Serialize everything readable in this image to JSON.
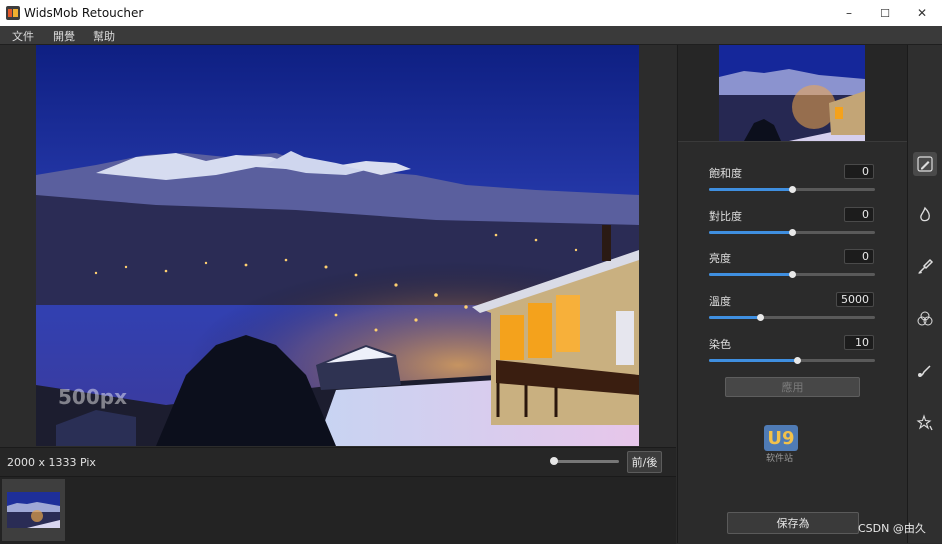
{
  "window": {
    "title": "WidsMob Retoucher",
    "controls": [
      "–",
      "☐",
      "✕"
    ]
  },
  "menu": [
    "文件",
    "開覺",
    "幫助"
  ],
  "image_info": "2000 x 1333 Pix",
  "image_watermark": "500px",
  "zoom": {
    "level": 0.05
  },
  "before_after_label": "前/後",
  "adjustments": [
    {
      "label": "飽和度",
      "value": "0",
      "position": 0.5
    },
    {
      "label": "對比度",
      "value": "0",
      "position": 0.5
    },
    {
      "label": "亮度",
      "value": "0",
      "position": 0.5
    },
    {
      "label": "溫度",
      "value": "5000",
      "position": 0.31
    },
    {
      "label": "染色",
      "value": "10",
      "position": 0.53
    }
  ],
  "apply_label": "應用",
  "watermark": {
    "text": "U9",
    "sub": "软件站"
  },
  "save_label": "保存為",
  "tools": [
    "pencil-icon",
    "flame-icon",
    "brush-icon",
    "color-circles-icon",
    "retouch-brush-icon",
    "magic-stars-icon"
  ],
  "credit": "CSDN @由久",
  "colors": {
    "accent": "#3f8fe0",
    "background": "#2b2b2b"
  }
}
